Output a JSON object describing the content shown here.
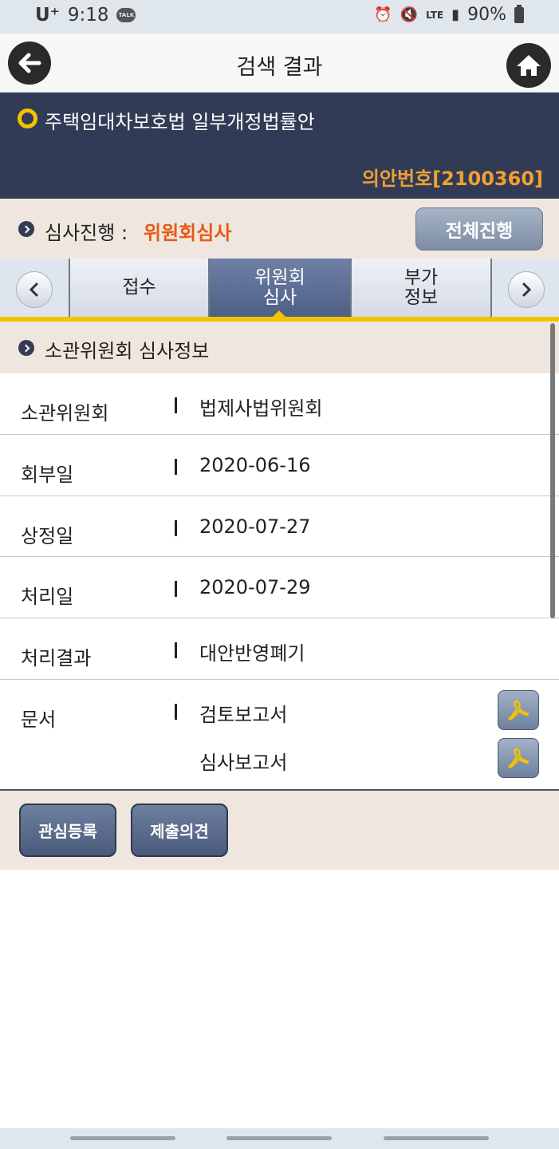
{
  "status_bar": {
    "carrier": "U⁺",
    "time": "9:18",
    "talk_badge": "TALK",
    "network": "LTE",
    "battery": "90%"
  },
  "header": {
    "title": "검색 결과"
  },
  "bill": {
    "title": "주택임대차보호법 일부개정법률안",
    "number": "의안번호[2100360]"
  },
  "progress": {
    "label": "심사진행 :",
    "value": "위원회심사",
    "full_button": "전체진행"
  },
  "tabs": [
    {
      "label_line1": "접수",
      "label_line2": ""
    },
    {
      "label_line1": "위원회",
      "label_line2": "심사"
    },
    {
      "label_line1": "부가",
      "label_line2": "정보"
    }
  ],
  "section": {
    "title": "소관위원회 심사정보"
  },
  "info": [
    {
      "label": "소관위원회",
      "value": "법제사법위원회"
    },
    {
      "label": "회부일",
      "value": "2020-06-16"
    },
    {
      "label": "상정일",
      "value": "2020-07-27"
    },
    {
      "label": "처리일",
      "value": "2020-07-29"
    },
    {
      "label": "처리결과",
      "value": "대안반영폐기"
    }
  ],
  "documents": {
    "label": "문서",
    "items": [
      "검토보고서",
      "심사보고서"
    ]
  },
  "actions": {
    "interest": "관심등록",
    "opinion": "제출의견"
  },
  "colors": {
    "navy": "#323b56",
    "accent_orange": "#e85a14",
    "bill_number": "#f0a030",
    "tab_active": "#5a6b92",
    "highlight_yellow": "#f2c300"
  }
}
